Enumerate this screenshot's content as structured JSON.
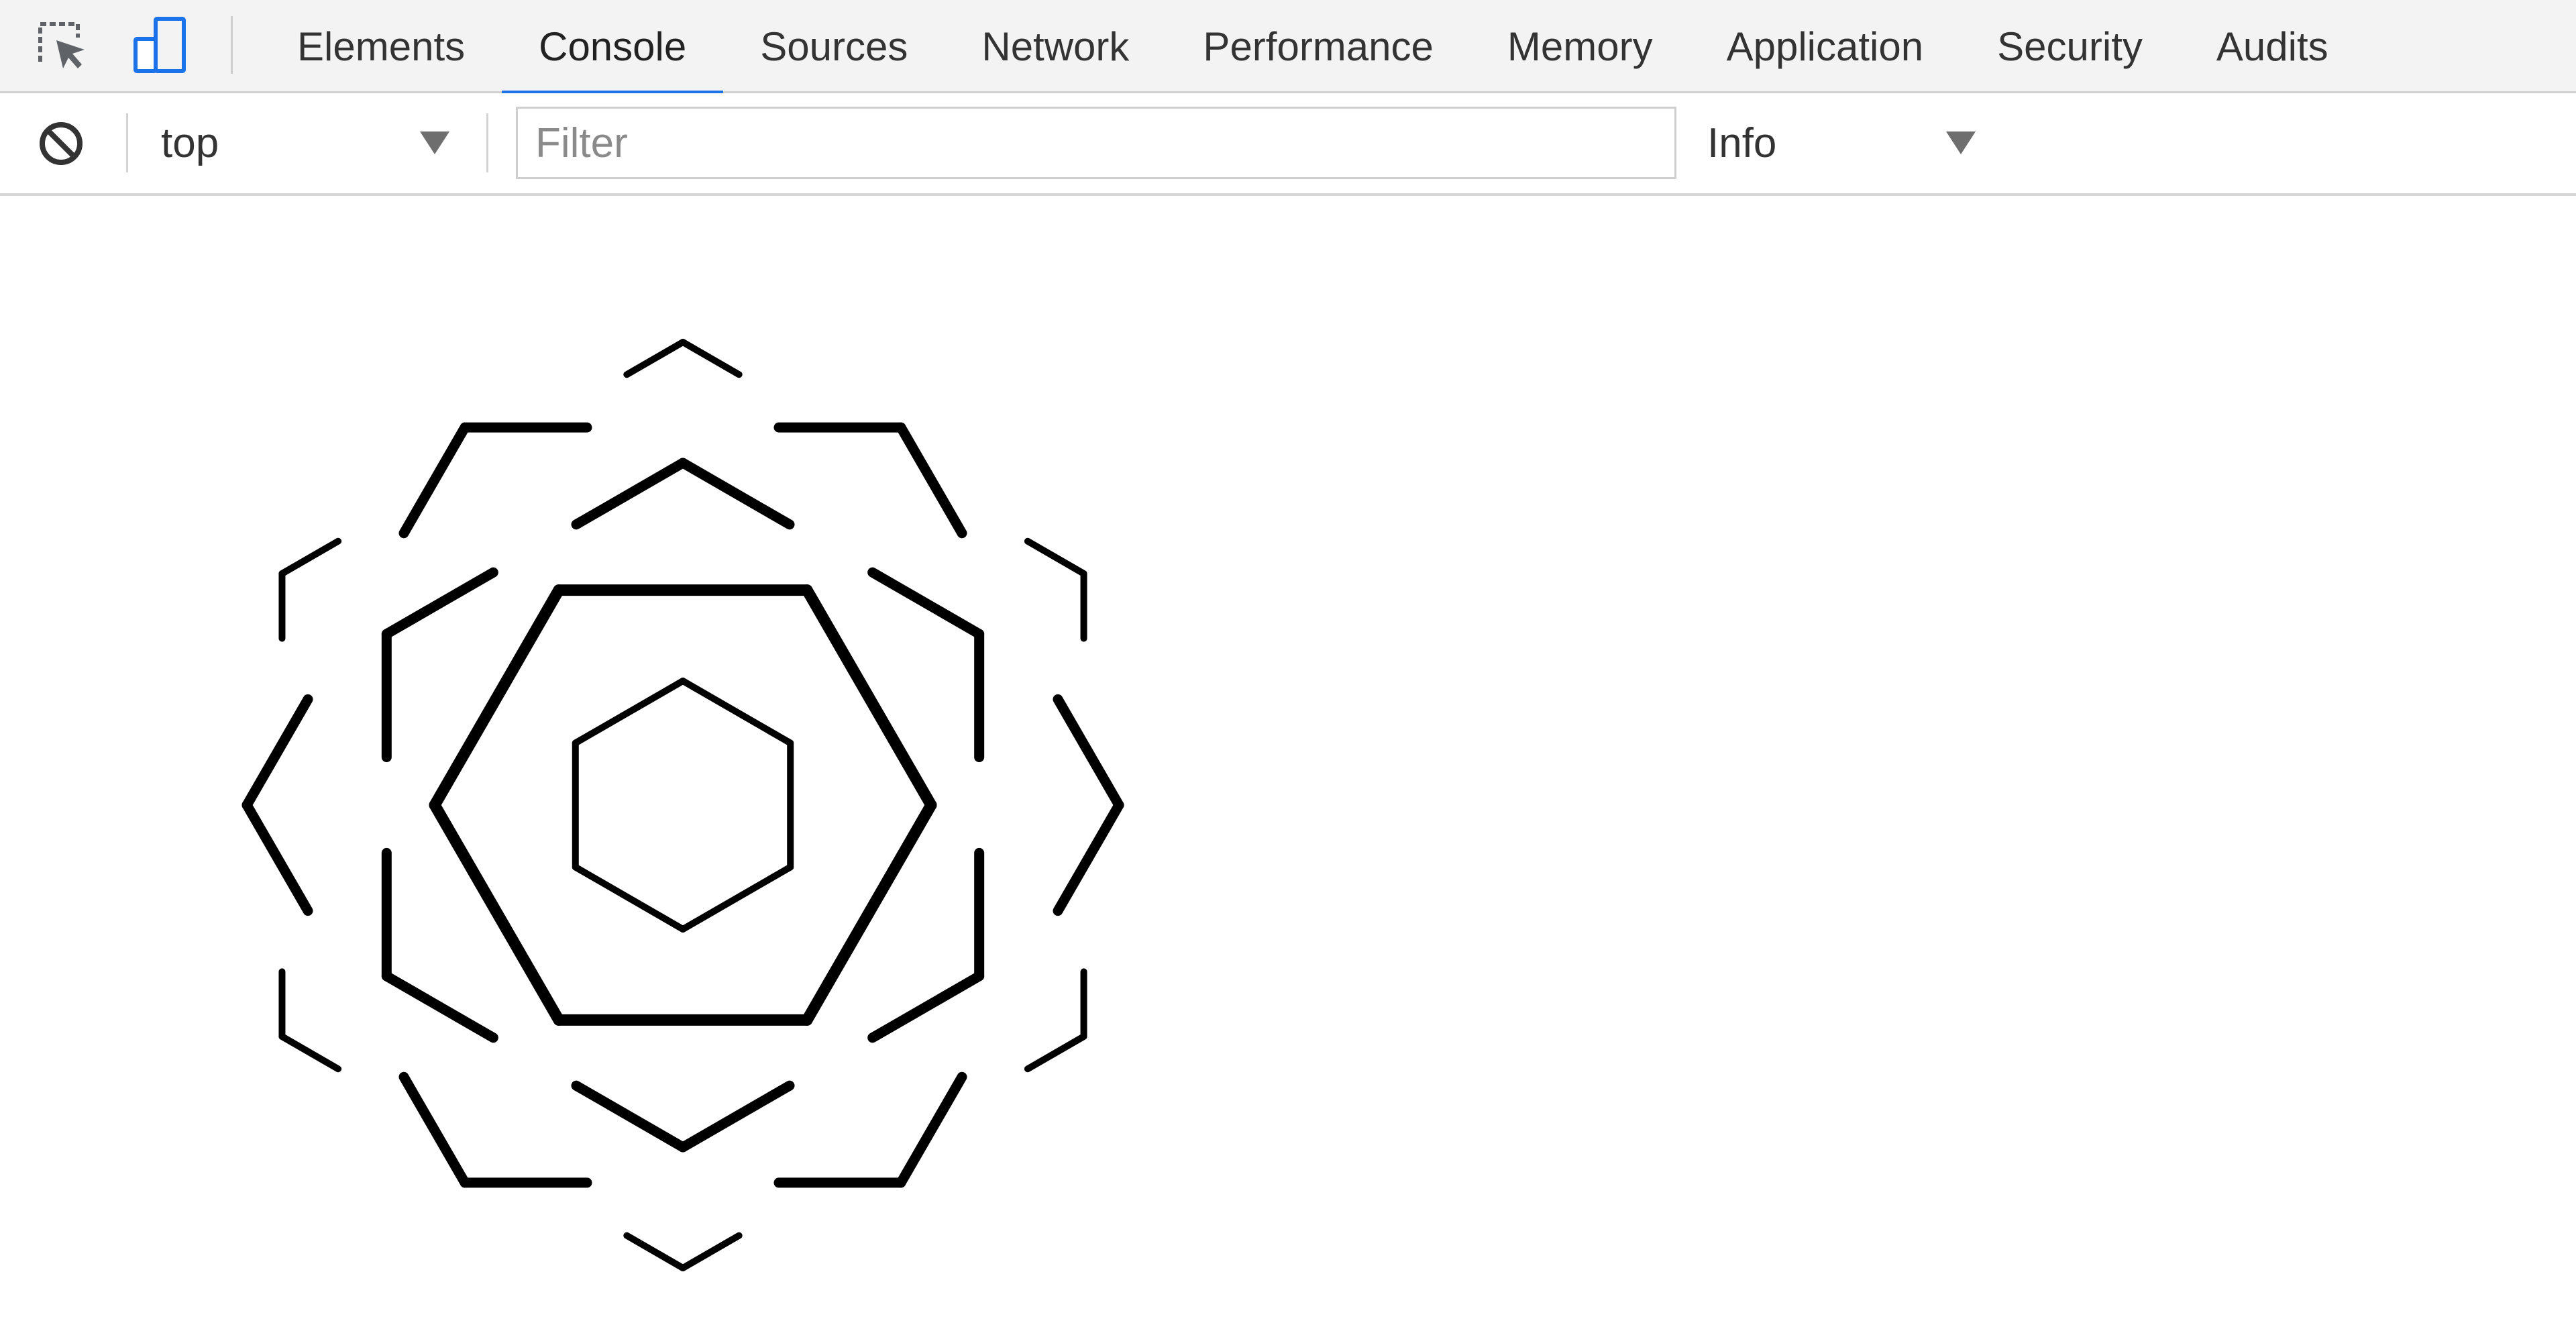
{
  "tabbar": {
    "tabs": [
      {
        "label": "Elements",
        "active": false
      },
      {
        "label": "Console",
        "active": true
      },
      {
        "label": "Sources",
        "active": false
      },
      {
        "label": "Network",
        "active": false
      },
      {
        "label": "Performance",
        "active": false
      },
      {
        "label": "Memory",
        "active": false
      },
      {
        "label": "Application",
        "active": false
      },
      {
        "label": "Security",
        "active": false
      },
      {
        "label": "Audits",
        "active": false
      }
    ],
    "inspect_icon": "inspect-element-icon",
    "device_icon": "device-toolbar-icon",
    "accent_color": "#1a73e8"
  },
  "toolbar": {
    "clear_icon": "clear-console-icon",
    "context": "top",
    "filter_placeholder": "Filter",
    "filter_value": "",
    "level": "Info"
  },
  "console": {
    "drawing_icon": "hexagon-mandala-drawing"
  }
}
